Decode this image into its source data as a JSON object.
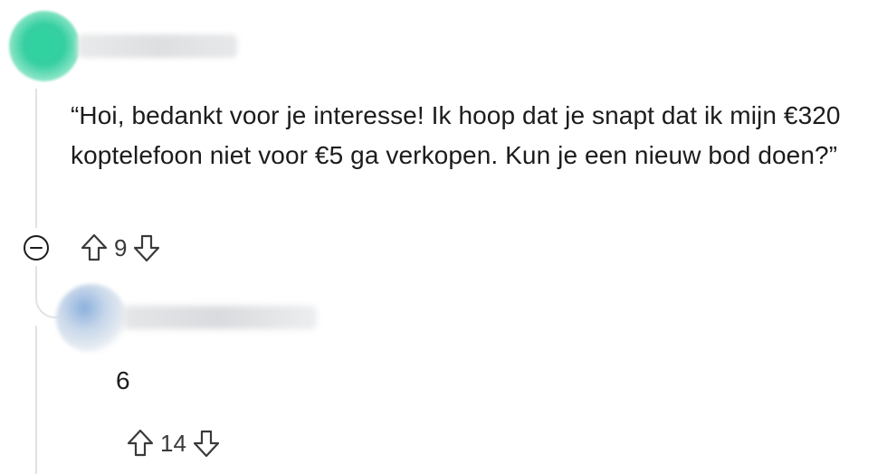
{
  "comment": {
    "text": "“Hoi, bedankt voor je interesse! Ik hoop dat je snapt dat ik mijn €320 koptelefoon niet voor €5 ga verkopen. Kun je een nieuw bod doen?”",
    "score": "9",
    "collapse_icon": "minus-circle-icon",
    "upvote_icon": "arrow-up-icon",
    "downvote_icon": "arrow-down-icon",
    "avatar_color": "#2fd3a0"
  },
  "reply": {
    "text": "6",
    "score": "14",
    "upvote_icon": "arrow-up-icon",
    "downvote_icon": "arrow-down-icon",
    "avatar_color": "#8bb0dd"
  }
}
